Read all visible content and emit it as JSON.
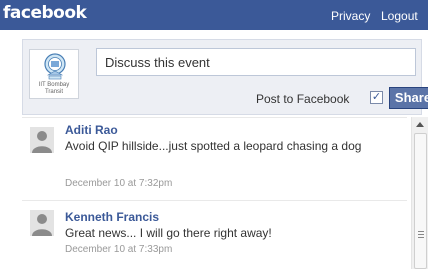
{
  "header": {
    "brand": "facebook",
    "links": [
      "Privacy",
      "Logout"
    ],
    "background": "#3b5998"
  },
  "composer": {
    "logo_text": [
      "IIT Bombay",
      "Transit"
    ],
    "placeholder": "Discuss this event",
    "post_to_label": "Post to Facebook",
    "post_to_checked": true,
    "share_label": "Share"
  },
  "feed": {
    "posts": [
      {
        "author": "Aditi Rao",
        "message": "Avoid QIP hillside...just spotted a leopard chasing a dog",
        "time": "December 10 at 7:32pm"
      },
      {
        "author": "Kenneth Francis",
        "message": "Great news... I will go there right away!",
        "time": "December 10 at 7:33pm"
      }
    ]
  },
  "colors": {
    "link": "#3b5998",
    "composer_bg": "#edeff4",
    "share_bg": "#5b74a8"
  }
}
